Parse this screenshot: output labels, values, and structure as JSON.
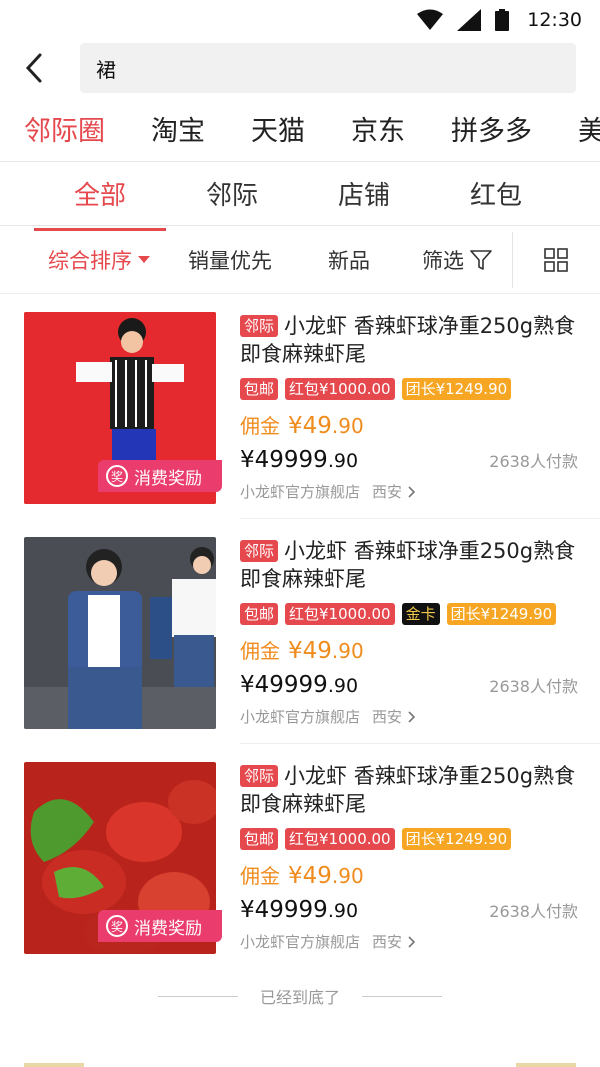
{
  "status_bar": {
    "time": "12:30"
  },
  "search": {
    "query": "裙"
  },
  "platform_tabs": [
    "邻际圈",
    "淘宝",
    "天猫",
    "京东",
    "拼多多",
    "美"
  ],
  "type_tabs": [
    "全部",
    "邻际",
    "店铺",
    "红包"
  ],
  "sort_bar": {
    "comprehensive": "综合排序",
    "sales": "销量优先",
    "new": "新品",
    "filter": "筛选"
  },
  "products": [
    {
      "source": "邻际",
      "title": "小龙虾 香辣虾球净重250g熟食即食麻辣虾尾",
      "badges": [
        {
          "text": "包邮",
          "style": "red"
        },
        {
          "text": "红包¥1000.00",
          "style": "red"
        },
        {
          "text": "团长¥1249.90",
          "style": "orange"
        }
      ],
      "commission_label": "佣金",
      "commission_int": "¥49",
      "commission_dec": ".90",
      "price_int": "¥49999",
      "price_dec": ".90",
      "sold": "2638人付款",
      "shop": "小龙虾官方旗舰店",
      "city": "西安",
      "reward": "消费奖励",
      "reward_icon": "奖"
    },
    {
      "source": "邻际",
      "title": "小龙虾 香辣虾球净重250g熟食即食麻辣虾尾",
      "badges": [
        {
          "text": "包邮",
          "style": "red"
        },
        {
          "text": "红包¥1000.00",
          "style": "red"
        },
        {
          "text": "金卡",
          "style": "gold"
        },
        {
          "text": "团长¥1249.90",
          "style": "orange"
        }
      ],
      "commission_label": "佣金",
      "commission_int": "¥49",
      "commission_dec": ".90",
      "price_int": "¥49999",
      "price_dec": ".90",
      "sold": "2638人付款",
      "shop": "小龙虾官方旗舰店",
      "city": "西安"
    },
    {
      "source": "邻际",
      "title": "小龙虾 香辣虾球净重250g熟食即食麻辣虾尾",
      "badges": [
        {
          "text": "包邮",
          "style": "red"
        },
        {
          "text": "红包¥1000.00",
          "style": "red"
        },
        {
          "text": "团长¥1249.90",
          "style": "orange"
        }
      ],
      "commission_label": "佣金",
      "commission_int": "¥49",
      "commission_dec": ".90",
      "price_int": "¥49999",
      "price_dec": ".90",
      "sold": "2638人付款",
      "shop": "小龙虾官方旗舰店",
      "city": "西安",
      "reward": "消费奖励",
      "reward_icon": "奖"
    }
  ],
  "end_text": "已经到底了",
  "colors": {
    "accent": "#e5484d",
    "orange": "#f08c1e",
    "reward": "#ea3d6e"
  }
}
